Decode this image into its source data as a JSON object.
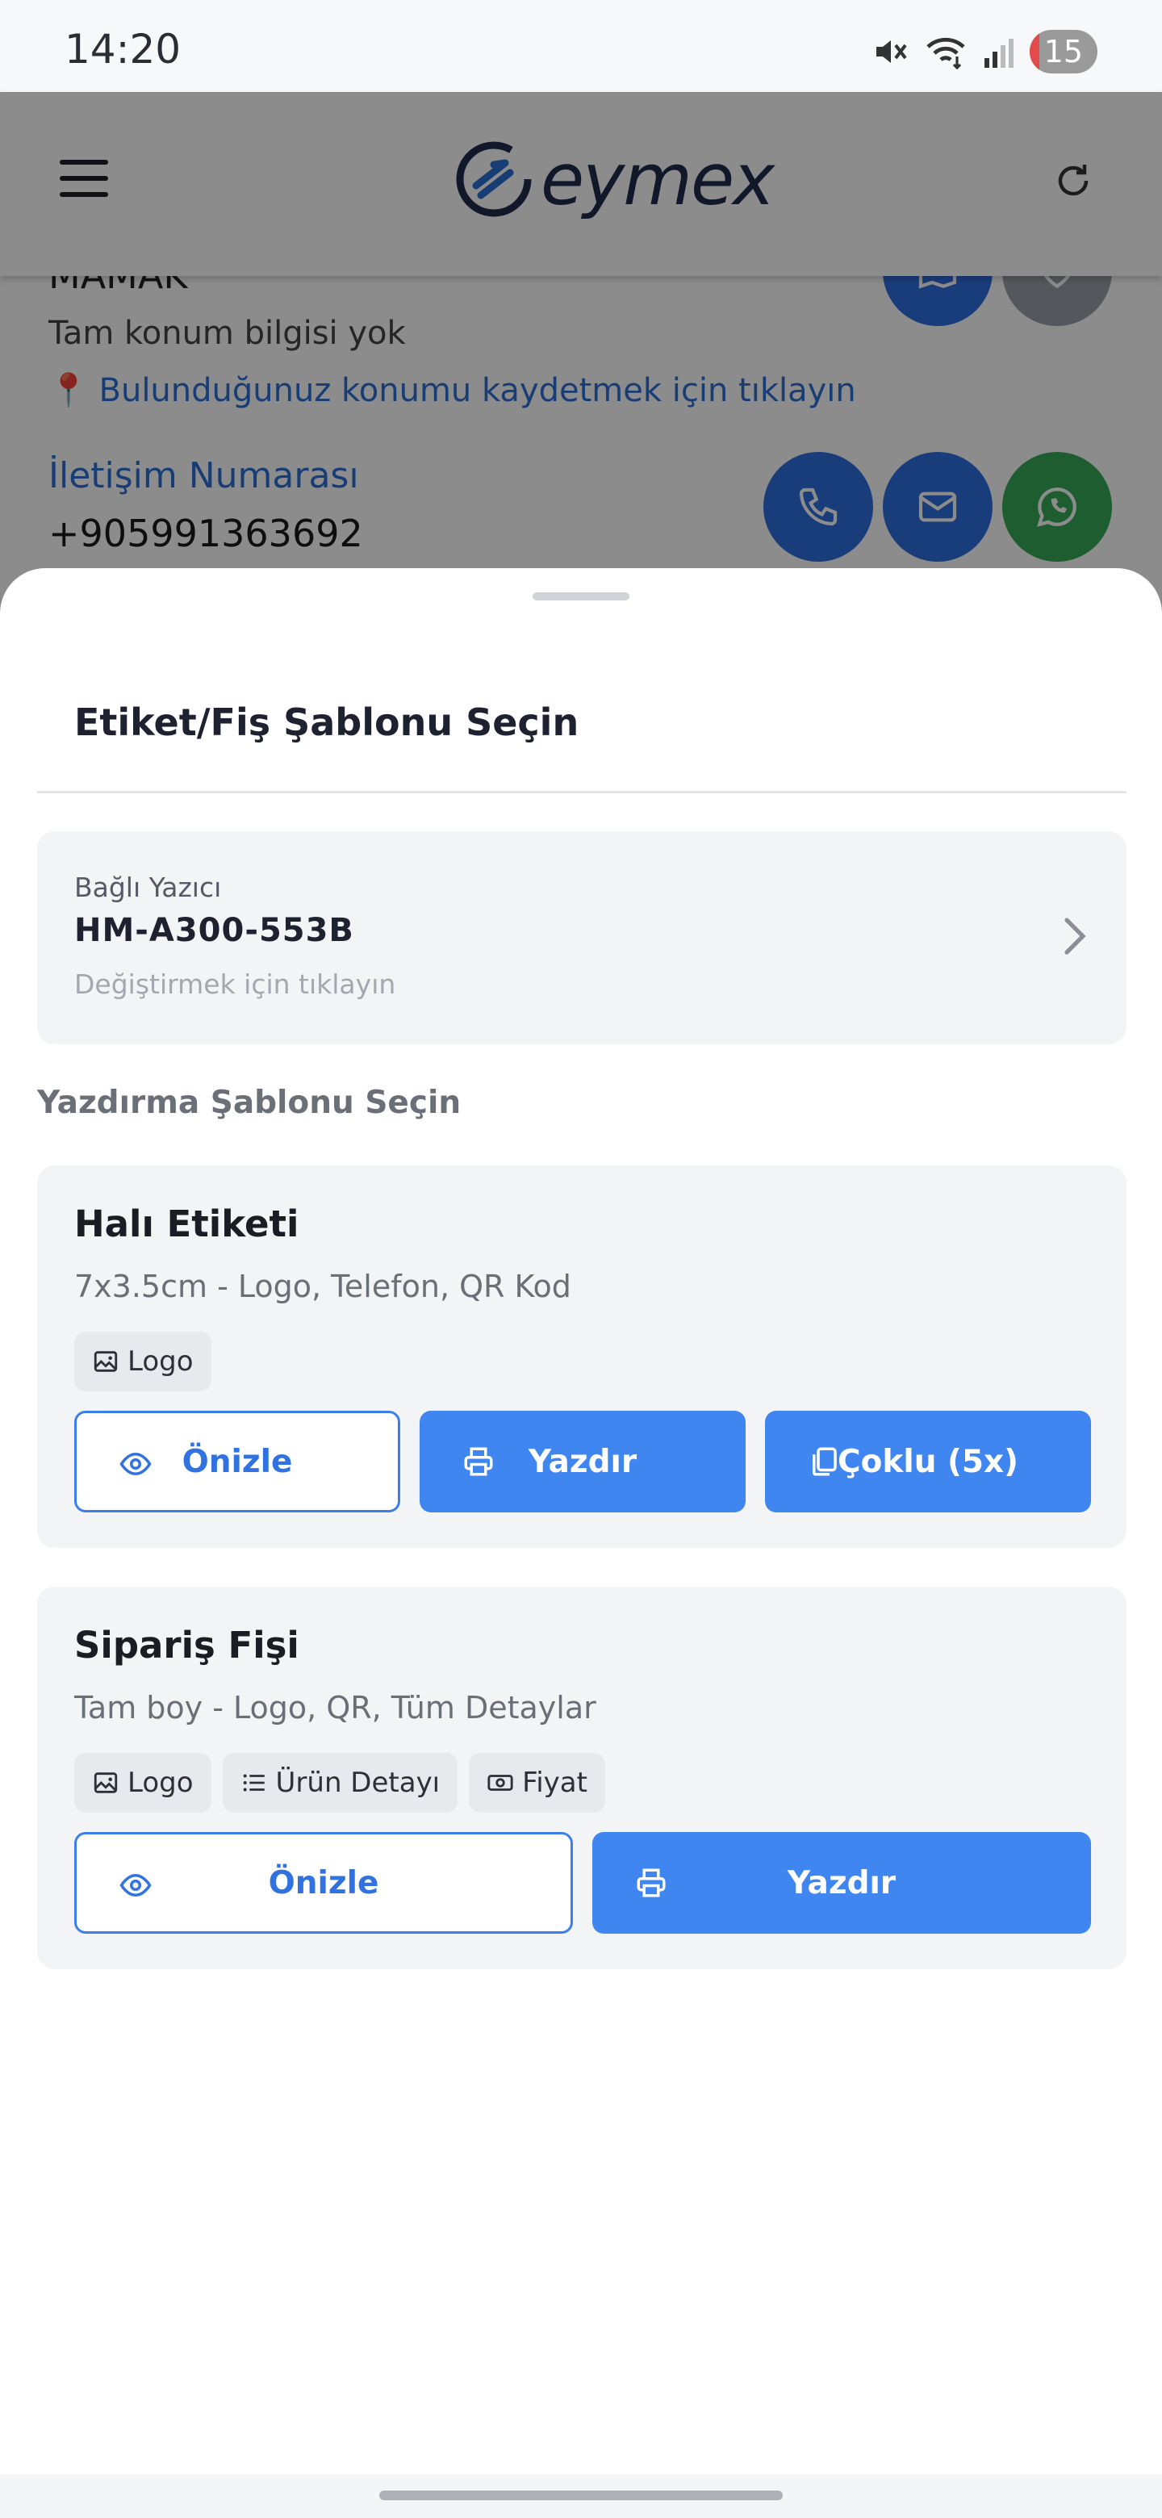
{
  "status_bar": {
    "time": "14:20",
    "battery": "15",
    "icons": [
      "mute-icon",
      "wifi-icon",
      "signal-icon",
      "battery-icon"
    ]
  },
  "header": {
    "brand": "eymex",
    "icons": [
      "menu-icon",
      "refresh-icon"
    ]
  },
  "background": {
    "district": "MAMAK",
    "location_info": "Tam konum bilgisi yok",
    "save_location_link": "📍 Bulunduğunuz konumu kaydetmek için tıklayın",
    "contact_label": "İletişim Numarası",
    "contact_number": "+905991363692",
    "action_icons": [
      "map-icon",
      "heart-icon",
      "phone-icon",
      "mail-icon",
      "whatsapp-icon"
    ]
  },
  "sheet": {
    "title": "Etiket/Fiş Şablonu Seçin",
    "printer": {
      "caption": "Bağlı Yazıcı",
      "name": "HM-A300-553B",
      "hint": "Değiştirmek için tıklayın"
    },
    "section_title": "Yazdırma Şablonu Seçin",
    "templates": [
      {
        "name": "Halı Etiketi",
        "description": "7x3.5cm - Logo, Telefon, QR Kod",
        "chips": [
          {
            "icon": "image-icon",
            "label": "Logo"
          }
        ],
        "buttons": {
          "preview": "Önizle",
          "print": "Yazdır",
          "multi": "Çoklu (5x)"
        }
      },
      {
        "name": "Sipariş Fişi",
        "description": "Tam boy - Logo, QR, Tüm Detaylar",
        "chips": [
          {
            "icon": "image-icon",
            "label": "Logo"
          },
          {
            "icon": "list-icon",
            "label": "Ürün Detayı"
          },
          {
            "icon": "money-icon",
            "label": "Fiyat"
          }
        ],
        "buttons": {
          "preview": "Önizle",
          "print": "Yazdır"
        }
      }
    ]
  },
  "colors": {
    "primary": "#3f86f0",
    "link": "#2d6fd6",
    "whatsapp": "#35a956",
    "card_bg": "#f3f4f6"
  }
}
